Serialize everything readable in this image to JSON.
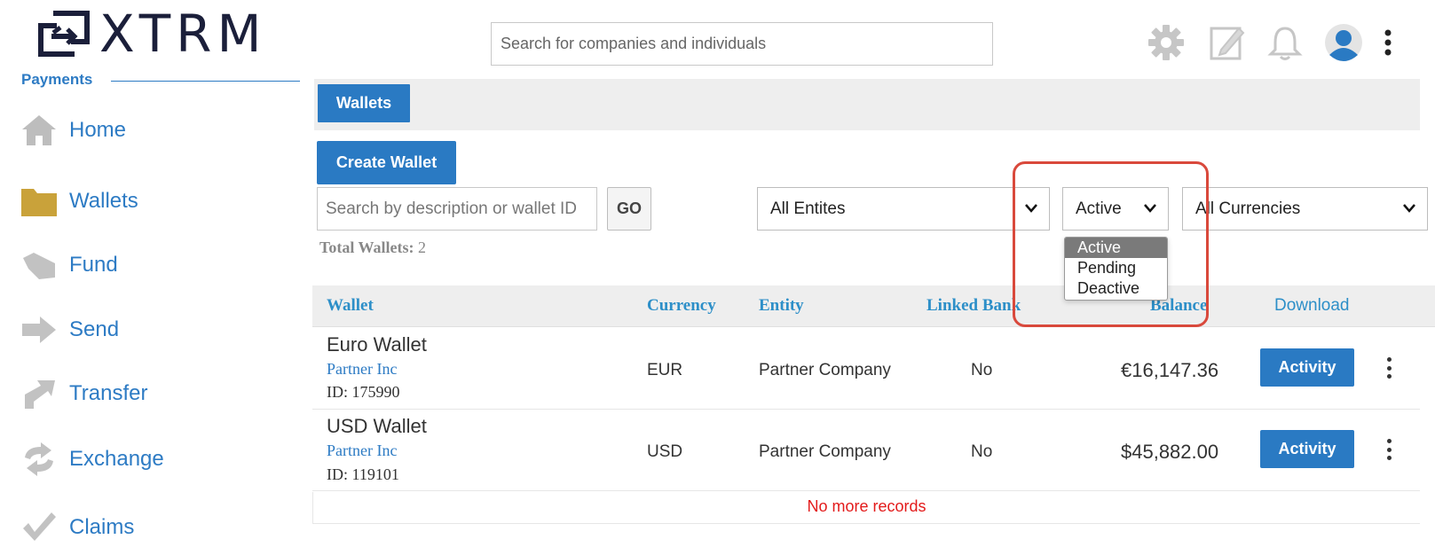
{
  "header": {
    "logo_text": "XTRM",
    "search_placeholder": "Search for companies and individuals",
    "icons": [
      "gear-icon",
      "edit-icon",
      "bell-icon",
      "user-avatar-icon",
      "more-vertical-icon"
    ]
  },
  "sidebar": {
    "section_title": "Payments",
    "items": [
      {
        "label": "Home",
        "icon": "home-icon"
      },
      {
        "label": "Wallets",
        "icon": "folder-icon"
      },
      {
        "label": "Fund",
        "icon": "fund-icon"
      },
      {
        "label": "Send",
        "icon": "send-arrow-icon"
      },
      {
        "label": "Transfer",
        "icon": "transfer-arrow-icon"
      },
      {
        "label": "Exchange",
        "icon": "exchange-icon"
      },
      {
        "label": "Claims",
        "icon": "checkmark-icon"
      }
    ]
  },
  "main": {
    "tab_label": "Wallets",
    "create_button": "Create Wallet",
    "wallet_search_placeholder": "Search by description or wallet ID",
    "go_button": "GO",
    "entity_filter": "All Entites",
    "status_filter": "Active",
    "currency_filter": "All Currencies",
    "total_label": "Total Wallets:",
    "total_value": "2",
    "status_options": [
      "Active",
      "Pending",
      "Deactive"
    ],
    "table": {
      "headers": {
        "wallet": "Wallet",
        "currency": "Currency",
        "entity": "Entity",
        "linked_bank": "Linked Bank",
        "balance": "Balance",
        "download": "Download"
      },
      "rows": [
        {
          "name": "Euro Wallet",
          "owner": "Partner Inc",
          "id": "ID: 175990",
          "currency": "EUR",
          "entity": "Partner Company",
          "linked_bank": "No",
          "balance": "€16,147.36",
          "action": "Activity"
        },
        {
          "name": "USD Wallet",
          "owner": "Partner Inc",
          "id": "ID: 119101",
          "currency": "USD",
          "entity": "Partner Company",
          "linked_bank": "No",
          "balance": "$45,882.00",
          "action": "Activity"
        }
      ],
      "footer": "No more records"
    }
  },
  "colors": {
    "primary": "#2a7ac3",
    "link": "#2d7bc4",
    "header_text": "#2d8fc8",
    "highlight": "#d9493c",
    "no_more": "#e31b1b",
    "folder": "#c9a23a"
  }
}
